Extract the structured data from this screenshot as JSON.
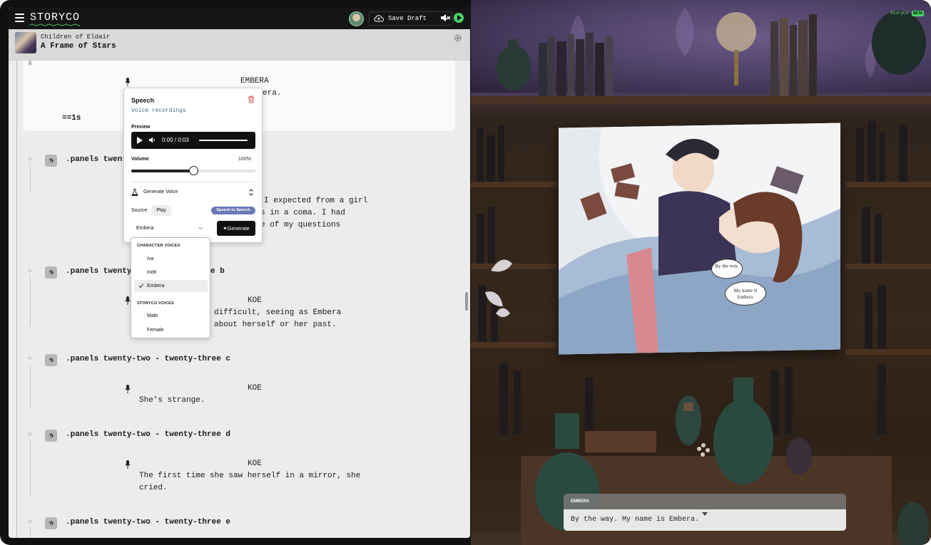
{
  "header": {
    "logo": "STORYCO",
    "save_label": "Save Draft"
  },
  "project": {
    "series": "Children of Eldair",
    "title": "A Frame of Stars"
  },
  "script": {
    "card": {
      "speaker": "EMBERA",
      "line_fragment": "era.",
      "pause": "==1s"
    },
    "blocks": [
      {
        "heading_fragment": ".panels twent",
        "dialog_lines": [
          "I expected from a girl",
          "s in a coma. I had",
          "e of my questions"
        ]
      },
      {
        "heading_fragment": ".panels twenty-",
        "heading_tail": "e b",
        "speaker": "KOE",
        "dialog_lines": [
          "difficult, seeing as Embera",
          "about herself or her past."
        ]
      },
      {
        "heading": ".panels twenty-two - twenty-three c",
        "speaker": "KOE",
        "dialog_lines": [
          "She's strange."
        ]
      },
      {
        "heading": ".panels twenty-two - twenty-three d",
        "speaker": "KOE",
        "dialog_lines": [
          "The first time she saw herself in a mirror, she",
          "cried."
        ]
      },
      {
        "heading": ".panels twenty-two - twenty-three e"
      }
    ]
  },
  "speech_popover": {
    "title": "Speech",
    "subtitle": "Voice recordings",
    "preview_label": "Preview",
    "player_time": "0:00 / 0:03",
    "volume_label": "Volume",
    "volume_value": "100%",
    "volume_level": 0.5,
    "generate_voice_label": "Generate Voice",
    "source_label": "Source:",
    "source_play": "Play",
    "speech_to_speech": "Speech to Speech",
    "selected_voice": "Embera",
    "generate_button": "Generate"
  },
  "voice_dropdown": {
    "character_header": "CHARACTER VOICES",
    "character_voices": [
      "Iva",
      "Indri",
      "Embera"
    ],
    "storyco_header": "STORYCO VOICES",
    "storyco_voices": [
      "Male",
      "Female"
    ],
    "selected": "Embera"
  },
  "scene": {
    "brand": "StoryCo",
    "beta": "BETA",
    "bubble_1": "By the way.",
    "bubble_2": "My name is Embera.",
    "dialog_speaker": "EMBERA",
    "dialog_text": "By the way. My name is Embera."
  },
  "colors": {
    "accent_green": "#49d36a",
    "speech_to_speech_badge": "#6c77b5",
    "topbar": "#151515",
    "trash_red": "#d9534f"
  }
}
